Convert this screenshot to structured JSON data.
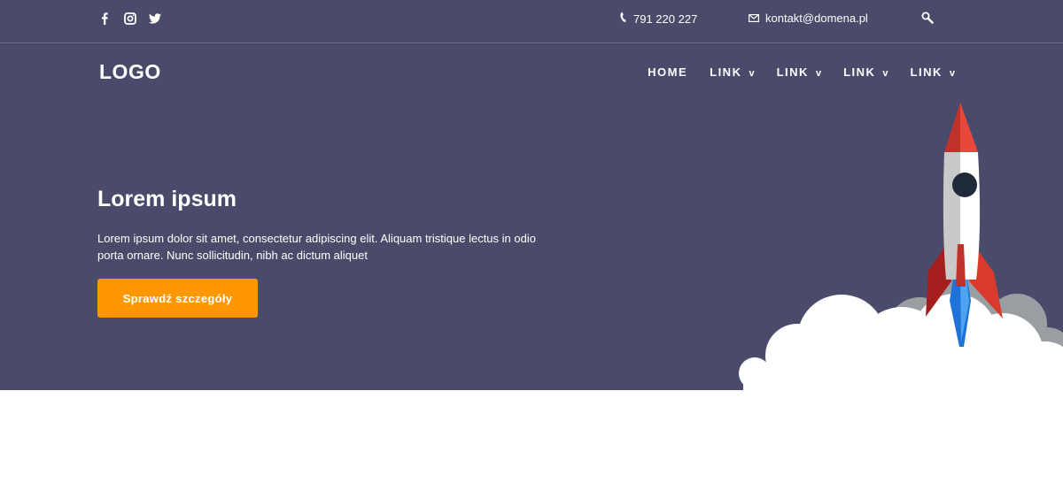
{
  "topbar": {
    "social": [
      {
        "icon": "facebook-icon"
      },
      {
        "icon": "instagram-icon"
      },
      {
        "icon": "twitter-icon"
      }
    ],
    "phone": "791 220 227",
    "email": "kontakt@domena.pl",
    "search_icon": "search-icon"
  },
  "header": {
    "logo": "LOGO",
    "nav": [
      {
        "label": "HOME",
        "caret": ""
      },
      {
        "label": "LINK",
        "caret": "v"
      },
      {
        "label": "LINK",
        "caret": "v"
      },
      {
        "label": "LINK",
        "caret": "v"
      },
      {
        "label": "LINK",
        "caret": "v"
      }
    ]
  },
  "hero": {
    "title": "Lorem ipsum",
    "description": "Lorem ipsum dolor sit amet, consectetur adipiscing elit. Aliquam tristique lectus in odio porta ornare. Nunc sollicitudin, nibh ac dictum aliquet",
    "cta_label": "Sprawdź szczegóły"
  },
  "colors": {
    "hero_bg": "#4a4a6a",
    "accent": "#ff9800",
    "text": "#ffffff"
  }
}
